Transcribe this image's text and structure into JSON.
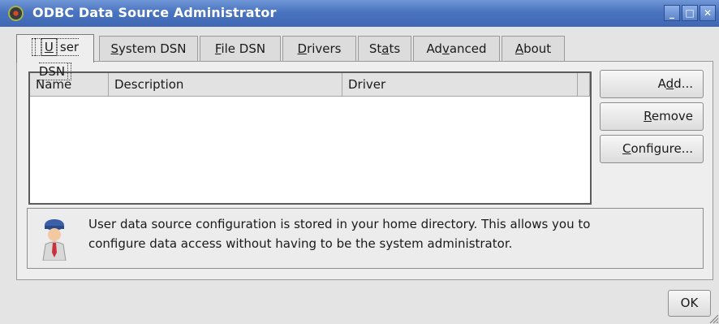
{
  "window": {
    "title": "ODBC Data Source Administrator"
  },
  "tabs": [
    {
      "pre": "",
      "u": "U",
      "post": "ser DSN"
    },
    {
      "pre": "",
      "u": "S",
      "post": "ystem DSN"
    },
    {
      "pre": "",
      "u": "F",
      "post": "ile DSN"
    },
    {
      "pre": "",
      "u": "D",
      "post": "rivers"
    },
    {
      "pre": "St",
      "u": "a",
      "post": "ts"
    },
    {
      "pre": "Ad",
      "u": "v",
      "post": "anced"
    },
    {
      "pre": "",
      "u": "A",
      "post": "bout"
    }
  ],
  "list": {
    "columns": [
      "Name",
      "Description",
      "Driver"
    ]
  },
  "buttons": {
    "add": {
      "pre": "A",
      "u": "d",
      "post": "d..."
    },
    "remove": {
      "pre": "",
      "u": "R",
      "post": "emove"
    },
    "configure": {
      "pre": "",
      "u": "C",
      "post": "onfigure..."
    },
    "ok": "OK"
  },
  "info": {
    "line1": "User data source configuration is stored in your home directory. This allows you to",
    "line2": "configure data access without having to be the system administrator."
  },
  "colors": {
    "titlebar": "#4b74c0",
    "accent_tie": "#c8323c"
  }
}
